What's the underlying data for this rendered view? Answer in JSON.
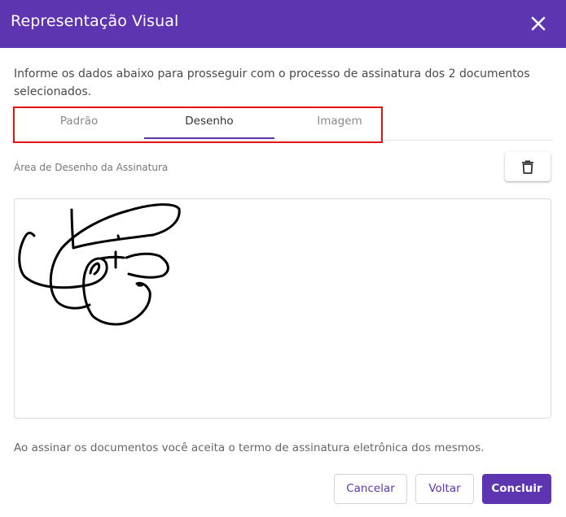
{
  "dialog": {
    "title": "Representação Visual",
    "intro": "Informe os dados abaixo para prosseguir com o processo de assinatura dos 2 documentos selecionados."
  },
  "tabs": [
    {
      "label": "Padrão",
      "active": false
    },
    {
      "label": "Desenho",
      "active": true
    },
    {
      "label": "Imagem",
      "active": false
    }
  ],
  "drawing": {
    "label": "Área de Desenho da Assinatura",
    "clear_icon": "trash-icon"
  },
  "terms": "Ao assinar os documentos você aceita o termo de assinatura eletrônica dos mesmos.",
  "actions": {
    "cancel": "Cancelar",
    "back": "Voltar",
    "confirm": "Concluir"
  },
  "colors": {
    "accent": "#5e35b1",
    "highlight_border": "#e51212"
  }
}
